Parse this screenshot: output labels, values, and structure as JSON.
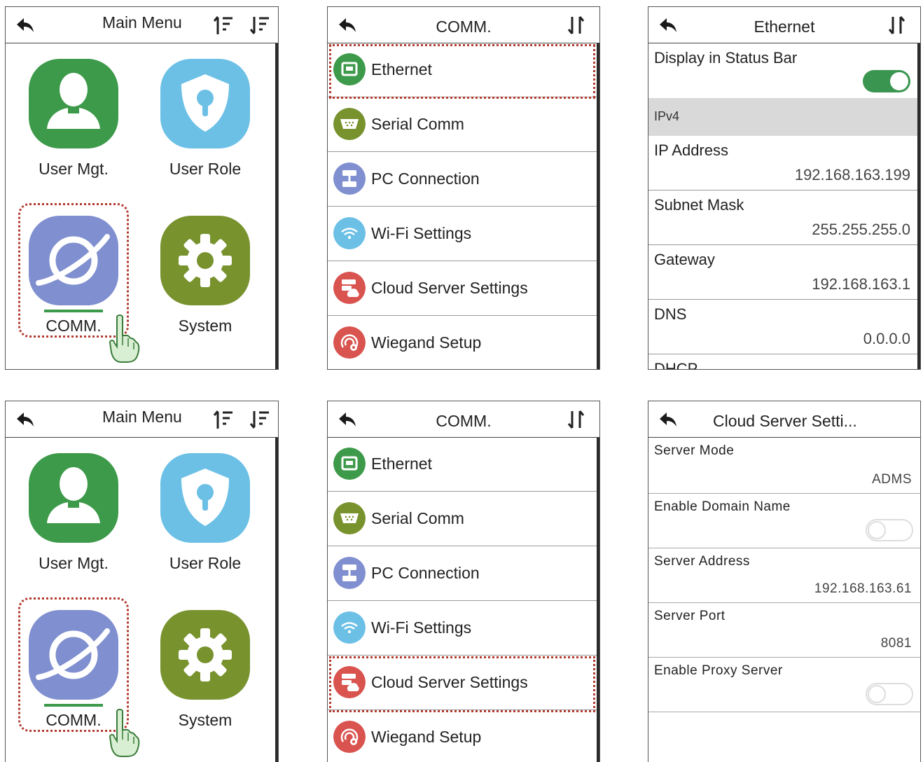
{
  "colors": {
    "green": "#3d9a4a",
    "blue_light": "#6cc0e6",
    "purple": "#7f8fcf",
    "olive": "#78922e",
    "red": "#d9534f",
    "highlight": "#b23a2f",
    "toggle_on": "#3a9550"
  },
  "main_menu": {
    "title": "Main Menu",
    "items": [
      {
        "label": "User Mgt.",
        "icon": "user-icon"
      },
      {
        "label": "User Role",
        "icon": "shield-icon"
      },
      {
        "label": "COMM.",
        "icon": "planet-icon"
      },
      {
        "label": "System",
        "icon": "gear-icon"
      }
    ]
  },
  "comm": {
    "title": "COMM.",
    "items": [
      {
        "label": "Ethernet",
        "icon": "ethernet-icon"
      },
      {
        "label": "Serial Comm",
        "icon": "serial-icon"
      },
      {
        "label": "PC Connection",
        "icon": "pc-connection-icon"
      },
      {
        "label": "Wi-Fi Settings",
        "icon": "wifi-icon"
      },
      {
        "label": "Cloud Server Settings",
        "icon": "cloud-server-icon"
      },
      {
        "label": "Wiegand Setup",
        "icon": "wiegand-icon"
      }
    ]
  },
  "ethernet": {
    "title": "Ethernet",
    "display_status_bar": "Display in Status Bar",
    "section": "IPv4",
    "rows": [
      {
        "label": "IP Address",
        "value": "192.168.163.199"
      },
      {
        "label": "Subnet Mask",
        "value": "255.255.255.0"
      },
      {
        "label": "Gateway",
        "value": "192.168.163.1"
      },
      {
        "label": "DNS",
        "value": "0.0.0.0"
      }
    ],
    "partial_label": "DHCP"
  },
  "cloud": {
    "title": "Cloud Server Setti...",
    "server_mode_label": "Server Mode",
    "server_mode_value": "ADMS",
    "enable_domain_label": "Enable Domain Name",
    "server_address_label": "Server Address",
    "server_address_value": "192.168.163.61",
    "server_port_label": "Server Port",
    "server_port_value": "8081",
    "enable_proxy_label": "Enable Proxy Server"
  }
}
